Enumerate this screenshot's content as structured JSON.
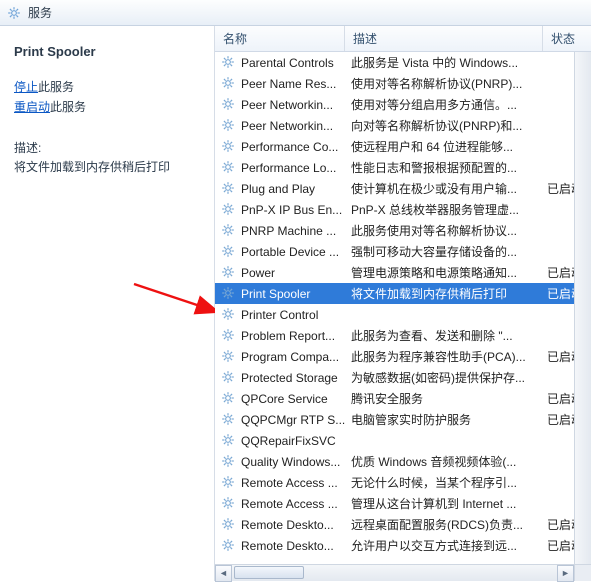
{
  "window": {
    "title": "服务"
  },
  "left": {
    "title": "Print Spooler",
    "stop_link": "停止",
    "stop_suffix": "此服务",
    "restart_link": "重启动",
    "restart_suffix": "此服务",
    "desc_label": "描述:",
    "desc_text": "将文件加载到内存供稍后打印"
  },
  "columns": {
    "name": "名称",
    "desc": "描述",
    "status": "状态"
  },
  "services": [
    {
      "name": "Parental Controls",
      "desc": "此服务是 Vista 中的 Windows...",
      "status": ""
    },
    {
      "name": "Peer Name Res...",
      "desc": "使用对等名称解析协议(PNRP)...",
      "status": ""
    },
    {
      "name": "Peer Networkin...",
      "desc": "使用对等分组启用多方通信。...",
      "status": ""
    },
    {
      "name": "Peer Networkin...",
      "desc": "向对等名称解析协议(PNRP)和...",
      "status": ""
    },
    {
      "name": "Performance Co...",
      "desc": "使远程用户和 64 位进程能够...",
      "status": ""
    },
    {
      "name": "Performance Lo...",
      "desc": "性能日志和警报根据预配置的...",
      "status": ""
    },
    {
      "name": "Plug and Play",
      "desc": "使计算机在极少或没有用户输...",
      "status": "已启动"
    },
    {
      "name": "PnP-X IP Bus En...",
      "desc": "PnP-X 总线枚举器服务管理虚...",
      "status": ""
    },
    {
      "name": "PNRP Machine ...",
      "desc": "此服务使用对等名称解析协议...",
      "status": ""
    },
    {
      "name": "Portable Device ...",
      "desc": "强制可移动大容量存储设备的...",
      "status": ""
    },
    {
      "name": "Power",
      "desc": "管理电源策略和电源策略通知...",
      "status": "已启动"
    },
    {
      "name": "Print Spooler",
      "desc": "将文件加载到内存供稍后打印",
      "status": "已启动",
      "selected": true
    },
    {
      "name": "Printer Control",
      "desc": "",
      "status": ""
    },
    {
      "name": "Problem Report...",
      "desc": "此服务为查看、发送和删除 \"...",
      "status": ""
    },
    {
      "name": "Program Compa...",
      "desc": "此服务为程序兼容性助手(PCA)...",
      "status": "已启动"
    },
    {
      "name": "Protected Storage",
      "desc": "为敏感数据(如密码)提供保护存...",
      "status": ""
    },
    {
      "name": "QPCore Service",
      "desc": "腾讯安全服务",
      "status": "已启动"
    },
    {
      "name": "QQPCMgr RTP S...",
      "desc": "电脑管家实时防护服务",
      "status": "已启动"
    },
    {
      "name": "QQRepairFixSVC",
      "desc": "",
      "status": ""
    },
    {
      "name": "Quality Windows...",
      "desc": "优质 Windows 音频视频体验(...",
      "status": ""
    },
    {
      "name": "Remote Access ...",
      "desc": "无论什么时候，当某个程序引...",
      "status": ""
    },
    {
      "name": "Remote Access ...",
      "desc": "管理从这台计算机到 Internet ...",
      "status": ""
    },
    {
      "name": "Remote Deskto...",
      "desc": "远程桌面配置服务(RDCS)负责...",
      "status": "已启动"
    },
    {
      "name": "Remote Deskto...",
      "desc": "允许用户以交互方式连接到远...",
      "status": "已启动"
    }
  ]
}
